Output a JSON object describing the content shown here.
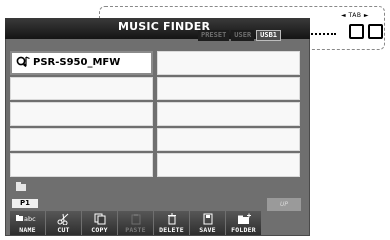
{
  "window": {
    "title": "MUSIC FINDER"
  },
  "tabs": [
    {
      "label": "PRESET",
      "active": false
    },
    {
      "label": "USER",
      "active": false
    },
    {
      "label": "USB1",
      "active": true
    }
  ],
  "annotation": {
    "tab_hint": "◄ TAB ►"
  },
  "files": [
    {
      "label": "PSR-S950_MFW",
      "icon": "music-finder-file-icon",
      "selected": true
    }
  ],
  "page_indicator": "P1",
  "up_button": "UP",
  "toolbar": {
    "name_small": "abc",
    "name": "NAME",
    "cut": "CUT",
    "copy": "COPY",
    "paste": "PASTE",
    "delete": "DELETE",
    "save": "SAVE",
    "folder": "FOLDER"
  },
  "colors": {
    "screen_bg": "#6f6f6f",
    "cell_bg": "#f8f8f8",
    "title_bar": "#1a1a1a"
  }
}
